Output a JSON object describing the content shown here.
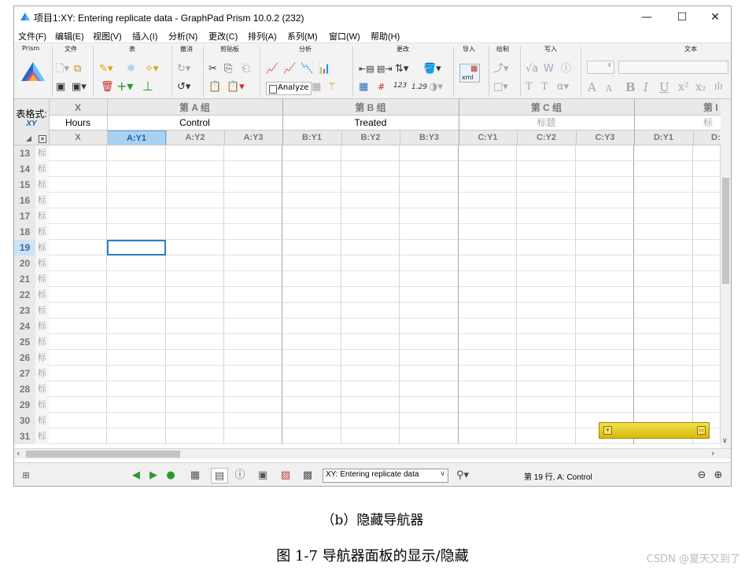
{
  "window": {
    "title": "项目1:XY: Entering replicate data - GraphPad Prism 10.0.2 (232)",
    "minimize": "—",
    "maximize": "☐",
    "close": "✕"
  },
  "menu": [
    "文件(F)",
    "编辑(E)",
    "视图(V)",
    "插入(I)",
    "分析(N)",
    "更改(C)",
    "排列(A)",
    "系列(M)",
    "窗口(W)",
    "帮助(H)"
  ],
  "ribbon_groups": [
    "Prism",
    "文件",
    "表",
    "撤消",
    "剪贴板",
    "分析",
    "更改",
    "导入",
    "绘制",
    "写入",
    "文本"
  ],
  "ribbon": {
    "analyze_label": "Analyze",
    "numbers_label": "123",
    "numbers2_label": "1.29",
    "xml_label": "xml"
  },
  "sheet": {
    "format_label": "表格式:",
    "format_value": "XY",
    "x_header": "X",
    "x_title": "Hours",
    "groups": [
      {
        "name": "第 A 组",
        "title": "Control",
        "title_muted": false,
        "cols": [
          "A:Y1",
          "A:Y2",
          "A:Y3"
        ]
      },
      {
        "name": "第 B 组",
        "title": "Treated",
        "title_muted": false,
        "cols": [
          "B:Y1",
          "B:Y2",
          "B:Y3"
        ]
      },
      {
        "name": "第 C 组",
        "title": "标题",
        "title_muted": true,
        "cols": [
          "C:Y1",
          "C:Y2",
          "C:Y3"
        ]
      },
      {
        "name": "第 I",
        "title": "标",
        "title_muted": true,
        "cols": [
          "D:Y1",
          "D:"
        ]
      }
    ],
    "x_col_label": "X",
    "rows": [
      "13",
      "14",
      "15",
      "16",
      "17",
      "18",
      "19",
      "20",
      "21",
      "22",
      "23",
      "24",
      "25",
      "26",
      "27",
      "28",
      "29",
      "30",
      "31"
    ],
    "row_tag": "标",
    "active_row": "19",
    "selected_column": "A:Y1"
  },
  "statusbar": {
    "sheet_selector": "XY: Entering replicate data",
    "position": "第 19 行, A: Control"
  },
  "caption": "（b）隐藏导航器",
  "figure_title": "图 1-7    导航器面板的显示/隐藏",
  "watermark": "CSDN @夏天又到了",
  "colors": {
    "selected_header": "#a9d2f2",
    "active_cell_border": "#2f7cc8",
    "float_panel": "#f0d020"
  }
}
